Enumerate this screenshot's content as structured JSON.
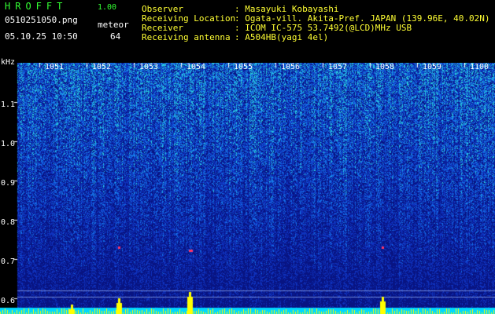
{
  "header": {
    "app_title": "HROFFT",
    "version": "1.00",
    "filename": "0510251050.png",
    "datetime": "05.10.25 10:50",
    "meteor_label": "meteor",
    "meteor_count": "64",
    "info": [
      {
        "label": "Observer",
        "value": ": Masayuki Kobayashi"
      },
      {
        "label": "Receiving Location",
        "value": ": Ogata-vill. Akita-Pref. JAPAN (139.96E, 40.02N)"
      },
      {
        "label": "Receiver",
        "value": ": ICOM IC-575 53.7492(@LCD)MHz USB"
      },
      {
        "label": "Receiving antenna",
        "value": ": A504HB(yagi 4el)"
      }
    ]
  },
  "spectrogram": {
    "y_unit": "kHz",
    "y_ticks": [
      "1.1",
      "1.0",
      "0.9",
      "0.8",
      "0.7",
      "0.6"
    ],
    "time_ticks": [
      "1051",
      "1052",
      "1053",
      "1054",
      "1055",
      "1056",
      "1057",
      "1058",
      "1059",
      "1100"
    ],
    "colors": {
      "background": "#0c1a8a",
      "noise": "#2a8ee0",
      "hot": "#ffff00",
      "baseline": "#00e5ff"
    }
  }
}
